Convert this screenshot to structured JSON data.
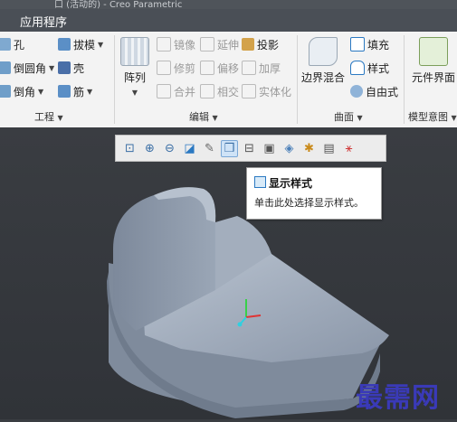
{
  "window": {
    "title": "口 (活动的) - Creo Parametric"
  },
  "menubar": {
    "active_tab": "应用程序"
  },
  "ribbon": {
    "engineering": {
      "items": [
        "孔",
        "倒圆角",
        "倒角",
        "拔模",
        "壳",
        "筋"
      ],
      "label": "工程"
    },
    "editing": {
      "array_label": "阵列",
      "items": [
        "镜像",
        "延伸",
        "投影",
        "修剪",
        "偏移",
        "加厚",
        "合并",
        "相交",
        "实体化"
      ],
      "label": "编辑"
    },
    "surface": {
      "blend_label": "边界混合",
      "items": [
        "填充",
        "样式",
        "自由式"
      ],
      "label": "曲面"
    },
    "model_intent": {
      "component_label": "元件界面",
      "label": "模型意图"
    }
  },
  "view_toolbar": {
    "buttons": [
      "refit-icon",
      "zoom-in-icon",
      "zoom-out-icon",
      "repaint-icon",
      "view-manager-icon",
      "display-style-icon",
      "saved-orientations-icon",
      "named-views-icon",
      "perspective-icon",
      "datum-display-icon",
      "annotation-display-icon",
      "spin-center-icon"
    ],
    "active": "display-style-icon"
  },
  "tooltip": {
    "title": "显示样式",
    "description": "单击此处选择显示样式。"
  },
  "watermark": "最需网",
  "colors": {
    "accent": "#2b79c2",
    "ribbon_bg": "#f3f3f3",
    "viewport_bg": "#3a3d42",
    "model": "#9aa6b6"
  }
}
